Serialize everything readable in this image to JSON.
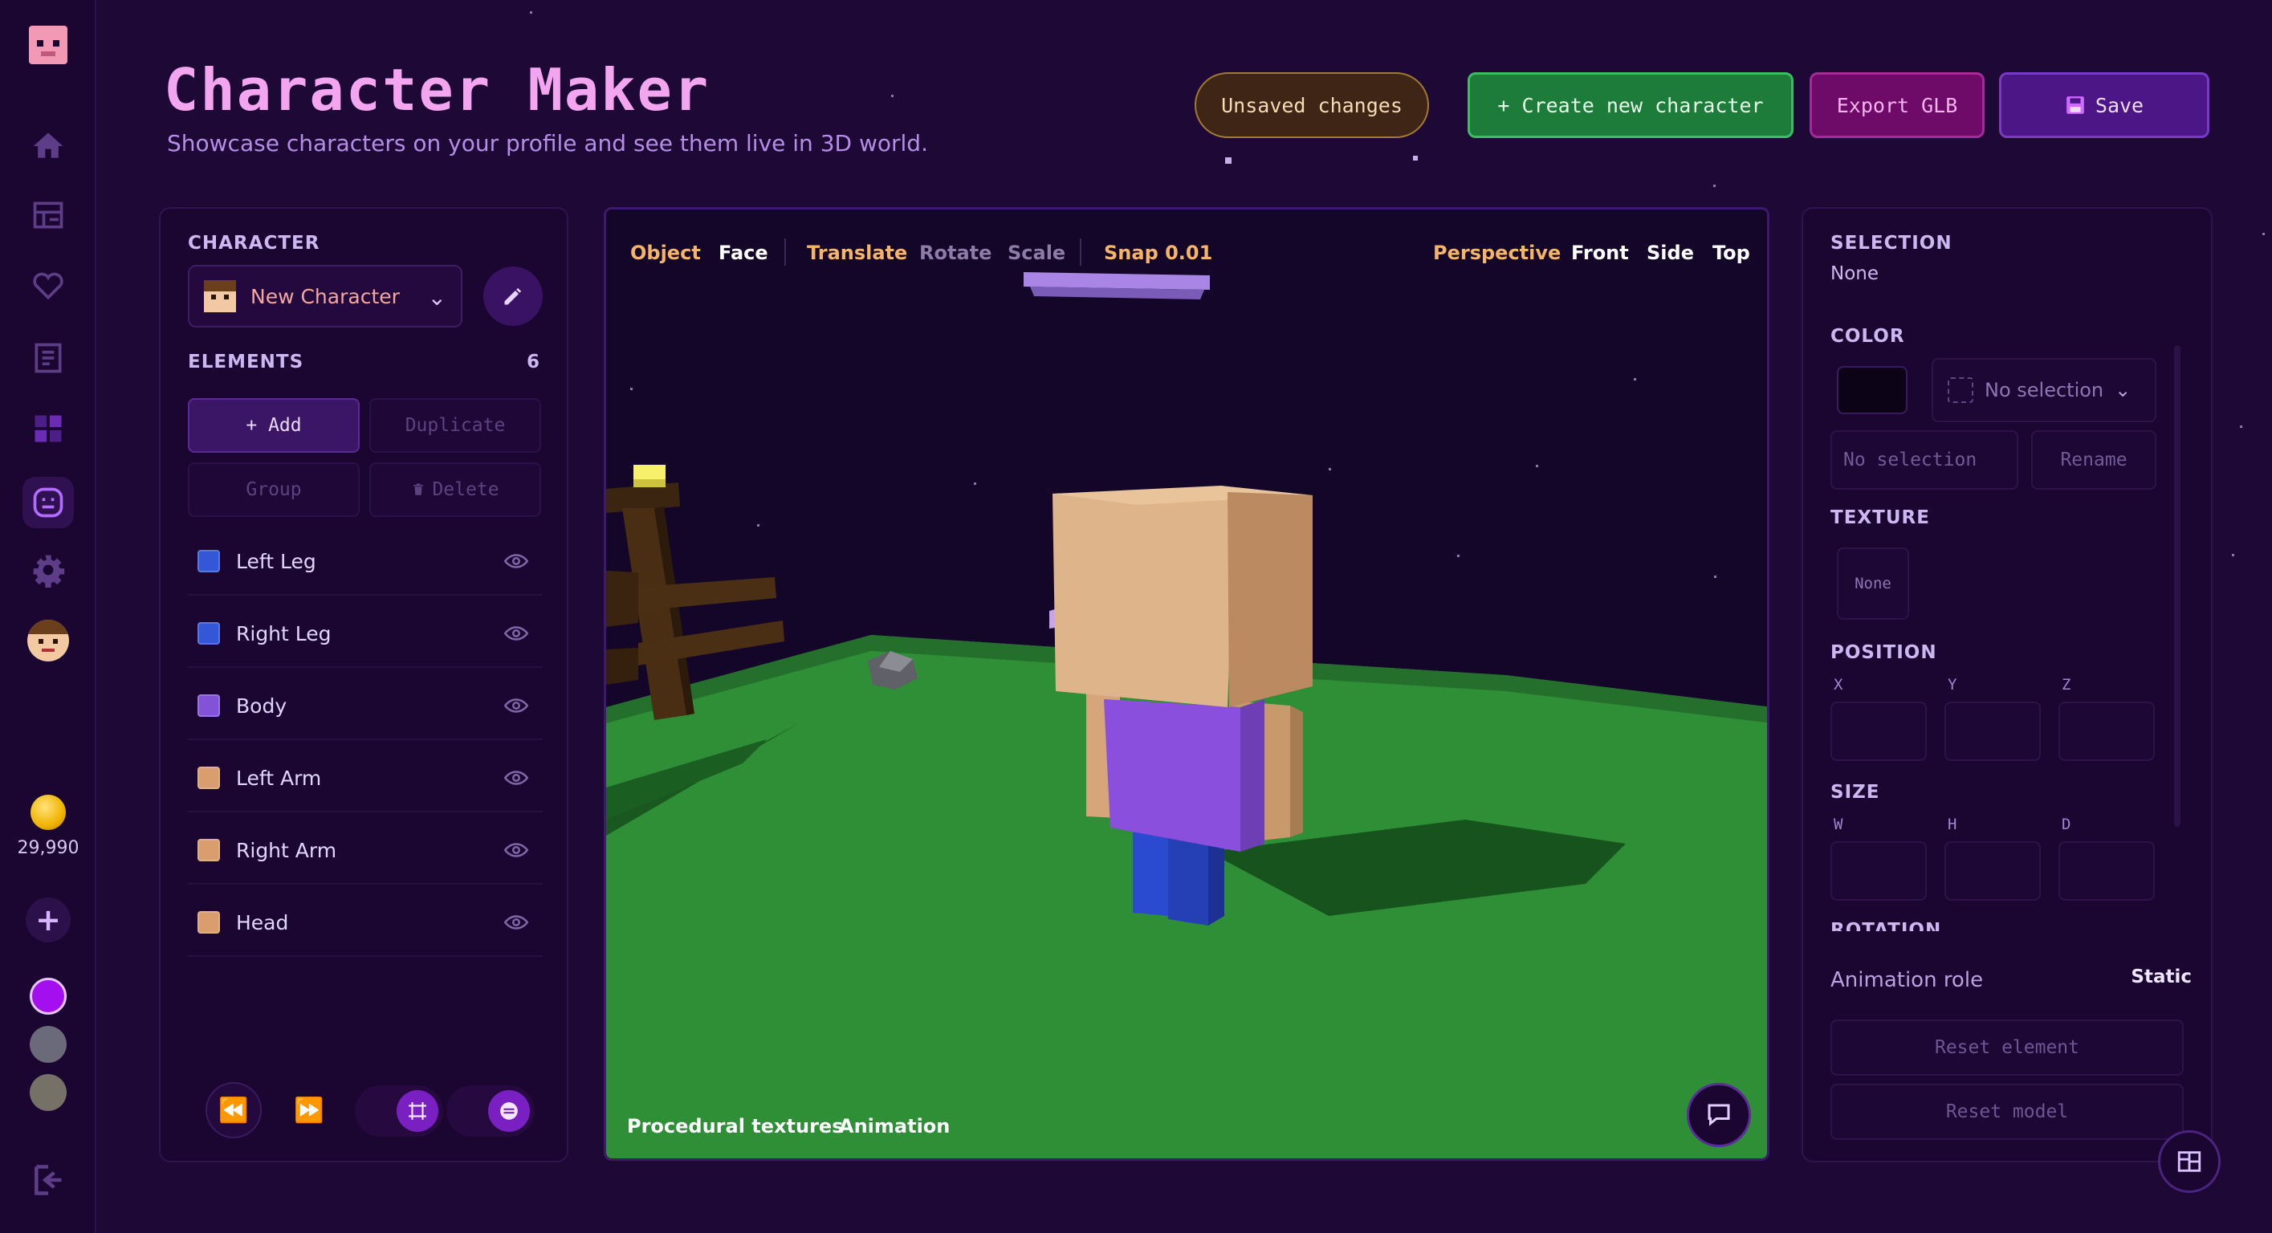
{
  "header": {
    "title": "Character Maker",
    "subtitle": "Showcase characters on your profile and see them live in 3D world.",
    "unsaved_label": "Unsaved changes",
    "create_label": "+ Create new character",
    "export_label": "Export GLB",
    "save_label": "Save"
  },
  "rail": {
    "coins": "29,990",
    "items": [
      "home-icon",
      "storefront-icon",
      "heart-icon",
      "document-icon",
      "grid-icon",
      "character-icon",
      "gear-icon"
    ],
    "swatches": [
      "#a40ff0",
      "#6b6a7a",
      "#757167"
    ]
  },
  "left_panel": {
    "character_label": "CHARACTER",
    "character_name": "New Character",
    "elements_label": "ELEMENTS",
    "elements_count": "6",
    "add_label": "+ Add",
    "duplicate_label": "Duplicate",
    "group_label": "Group",
    "delete_label": "Delete",
    "elements": [
      {
        "name": "Left Leg",
        "color": "#3357d6"
      },
      {
        "name": "Right Leg",
        "color": "#3357d6"
      },
      {
        "name": "Body",
        "color": "#8253d6"
      },
      {
        "name": "Left Arm",
        "color": "#d99d6e"
      },
      {
        "name": "Right Arm",
        "color": "#d99d6e"
      },
      {
        "name": "Head",
        "color": "#d99d6e"
      }
    ]
  },
  "viewport": {
    "tool_object": "Object",
    "tool_face": "Face",
    "tool_translate": "Translate",
    "tool_rotate": "Rotate",
    "tool_scale": "Scale",
    "snap": "Snap 0.01",
    "view_perspective": "Perspective",
    "view_front": "Front",
    "view_side": "Side",
    "view_top": "Top",
    "bottom_textures": "Procedural textures",
    "bottom_animation": "Animation",
    "colors": {
      "active": "#f5b468",
      "inactive": "#8e7ba8",
      "normal": "#ffffff",
      "ground": "#2b8f3a",
      "sky": "#140628"
    }
  },
  "right_panel": {
    "selection_label": "SELECTION",
    "selection_value": "None",
    "color_label": "COLOR",
    "color_select": "No selection",
    "name_placeholder": "No selection",
    "rename_label": "Rename",
    "texture_label": "TEXTURE",
    "texture_value": "None",
    "position_label": "POSITION",
    "pos_x": "X",
    "pos_y": "Y",
    "pos_z": "Z",
    "size_label": "SIZE",
    "size_w": "W",
    "size_h": "H",
    "size_d": "D",
    "rotation_label": "ROTATION",
    "animation_role_label": "Animation role",
    "animation_role_value": "Static",
    "reset_element": "Reset element",
    "reset_model": "Reset model"
  }
}
